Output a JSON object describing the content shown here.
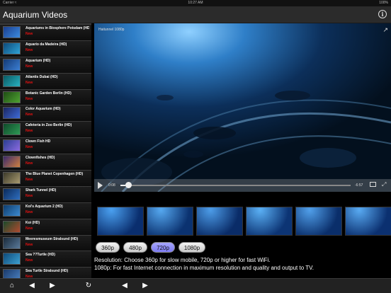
{
  "status": {
    "carrier": "Carrier ≈",
    "time": "10:27 AM",
    "battery": "100%"
  },
  "nav": {
    "title": "Aquarium Videos",
    "info_icon": "info-icon"
  },
  "videos": [
    {
      "title": "Aquariums in Biosphere Potsdam (HD)",
      "badge": "New",
      "thumb": [
        "#1a3f8f",
        "#3c8be0"
      ]
    },
    {
      "title": "Aquario da Madeira (HD)",
      "badge": "New",
      "thumb": [
        "#0d4a7a",
        "#2fa3d6"
      ]
    },
    {
      "title": "Aquarium (HD)",
      "badge": "New",
      "thumb": [
        "#143a75",
        "#3b7fd4"
      ]
    },
    {
      "title": "Atlantis Dubai (HD)",
      "badge": "New",
      "thumb": [
        "#0a5a63",
        "#28b1c0"
      ]
    },
    {
      "title": "Botanic Garden Berlin (HD)",
      "badge": "New",
      "thumb": [
        "#1f4d14",
        "#4fa332"
      ]
    },
    {
      "title": "Color Aquarium (HD)",
      "badge": "New",
      "thumb": [
        "#1a2660",
        "#3f6bd8"
      ]
    },
    {
      "title": "Cafeteria in Zoo Berlin (HD)",
      "badge": "New",
      "thumb": [
        "#0f4a2a",
        "#2e9a55"
      ]
    },
    {
      "title": "Clown Fish HD",
      "badge": "New",
      "thumb": [
        "#2a3f93",
        "#8c6be0"
      ]
    },
    {
      "title": "Clownfishes (HD)",
      "badge": "New",
      "thumb": [
        "#3a2a6b",
        "#d08040"
      ]
    },
    {
      "title": "The Blue Planet Copenhagen (HD)",
      "badge": "New",
      "thumb": [
        "#3d3a2a",
        "#a89a70"
      ]
    },
    {
      "title": "Shark Tunnel (HD)",
      "badge": "New",
      "thumb": [
        "#0a2a5a",
        "#2f6fc0"
      ]
    },
    {
      "title": "Koi's Aquarium 2 (HD)",
      "badge": "New",
      "thumb": [
        "#0e3d6e",
        "#3c8ad0"
      ]
    },
    {
      "title": "Koi (HD)",
      "badge": "New",
      "thumb": [
        "#1a4a2a",
        "#b04a30"
      ]
    },
    {
      "title": "Meeresmuseum Stralsund (HD)",
      "badge": "New",
      "thumb": [
        "#1a2a3a",
        "#5a7a9a"
      ]
    },
    {
      "title": "Sea ??Turtle (HD)",
      "badge": "New",
      "thumb": [
        "#0e4a7a",
        "#3ca0d0"
      ]
    },
    {
      "title": "Sea Turtle Stralsund (HD)",
      "badge": "New",
      "thumb": [
        "#1a3a6a",
        "#4a80c0"
      ]
    }
  ],
  "player": {
    "video_title": "Haitunnel 1080p",
    "elapsed": "0:08",
    "remaining": "-6:57",
    "progress": 0.02
  },
  "thumbnails": [
    [
      "#0a2e6e",
      "#4aa0f0"
    ],
    [
      "#0b3270",
      "#55a8f0"
    ],
    [
      "#0a2c68",
      "#4c9ce8"
    ],
    [
      "#0c3474",
      "#5ab0f5"
    ],
    [
      "#0a2e6a",
      "#509fea"
    ],
    [
      "#0b3070",
      "#58aaf2"
    ]
  ],
  "resolutions": [
    {
      "label": "360p",
      "active": false
    },
    {
      "label": "480p",
      "active": false
    },
    {
      "label": "720p",
      "active": true
    },
    {
      "label": "1080p",
      "active": false
    }
  ],
  "description": {
    "line1": "Resolution: Choose 360p for slow mobile, 720p or higher for fast WiFi.",
    "line2": "1080p: For fast Internet connection in maximum resolution and quality and output to TV."
  },
  "toolbar": {
    "home": "⌂",
    "prev": "◀",
    "next": "▶",
    "refresh": "↻",
    "prev2": "◀",
    "next2": "▶"
  },
  "colors": {
    "active_resolution": "#7b79f0",
    "badge_red": "#e11111"
  }
}
